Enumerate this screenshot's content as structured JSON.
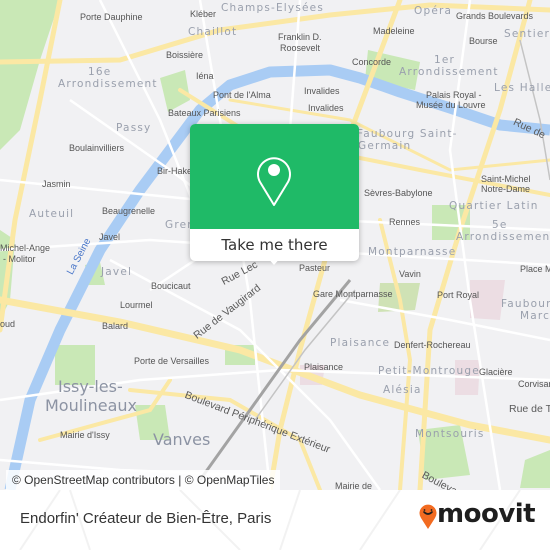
{
  "map": {
    "colors": {
      "land": "#f1f1f3",
      "water": "#a9ccf4",
      "park": "#c9e8b6",
      "major_road": "#fbe8a4",
      "minor_road": "#ffffff",
      "rail": "#a3a3a3",
      "brand_green": "#1fba67",
      "moovit_orange": "#f26b21"
    },
    "labels": {
      "porte_dauphine": "Porte Dauphine",
      "kleber": "Kléber",
      "champs_elysees": "Champs-Elysées",
      "chaillot": "Chaillot",
      "boissiere": "Boissière",
      "arr16_a": "16e",
      "arr16_b": "Arrondissement",
      "iena": "Iéna",
      "pont_alma": "Pont de l'Alma",
      "bateaux": "Bateaux Parisiens",
      "passy": "Passy",
      "franklin_a": "Franklin D.",
      "franklin_b": "Roosevelt",
      "madeleine": "Madeleine",
      "opera": "Opéra",
      "grands_boulevards": "Grands Boulevards",
      "bourse": "Bourse",
      "sentier": "Sentier",
      "concorde": "Concorde",
      "arr1_a": "1er",
      "arr1_b": "Arrondissement",
      "invalides_1": "Invalides",
      "invalides_2": "Invalides",
      "palais_a": "Palais Royal -",
      "palais_b": "Musée du Louvre",
      "les_halles": "Les Halles",
      "rue_de_top": "Rue de",
      "faubourg_sg_a": "Faubourg Saint-",
      "faubourg_sg_b": "Germain",
      "boulainvilliers": "Boulainvilliers",
      "bir_hakeim": "Bir-Hakeim",
      "jasmin": "Jasmin",
      "auteuil": "Auteuil",
      "beaugrenelle": "Beaugrenelle",
      "grenelle": "Grenelle",
      "michel_ange_a": "Michel-Ange",
      "michel_ange_b": "- Molitor",
      "javel_station": "Javel",
      "la_seine": "La Seine",
      "javel_district": "Javel",
      "boucicaut": "Boucicaut",
      "lourmel": "Lourmel",
      "saint_cloud": "oud",
      "saint_michel_a": "Saint-Michel",
      "saint_michel_b": "Notre-Dame",
      "sevres_babylone": "Sèvres-Babylone",
      "quartier_latin": "Quartier Latin",
      "rennes": "Rennes",
      "arr5_a": "5e",
      "arr5_b": "Arrondissement",
      "montparnasse": "Montparnasse",
      "place_monge": "Place M",
      "vavin": "Vavin",
      "gare_montparnasse": "Gare Montparnasse",
      "port_royal": "Port Royal",
      "faubourg_marcel_a": "Faubourg",
      "faubourg_marcel_b": "Marce",
      "rue_lecourbe": "Rue Lec",
      "pasteur": "Pasteur",
      "rue_vaugirard": "Rue de Vaugirard",
      "balard": "Balard",
      "porte_versailles": "Porte de Versailles",
      "issy_a": "Issy-les-",
      "issy_b": "Moulineaux",
      "mairie_issy": "Mairie d'Issy",
      "vanves": "Vanves",
      "bd_peripherique": "Boulevard Périphérique Extérieur",
      "plaisance_district": "Plaisance",
      "plaisance_station": "Plaisance",
      "denfert": "Denfert-Rochereau",
      "petit_montrouge": "Petit-Montrouge",
      "glaciere": "Glacière",
      "alesia": "Alésia",
      "corvisart": "Corvisar",
      "rue_de_right": "Rue de T",
      "montsouris": "Montsouris",
      "mairie_de": "Mairie de",
      "boulevard_bottom": "Boulevard"
    },
    "popup": {
      "button_label": "Take me there",
      "icon": "map-pin-icon"
    },
    "attribution": "© OpenStreetMap contributors | © OpenMapTiles"
  },
  "footer": {
    "place_name": "Endorfin' Créateur de Bien-Être, Paris",
    "logo_text": "moovit",
    "logo_icon": "moovit-smiley-pin-icon"
  }
}
